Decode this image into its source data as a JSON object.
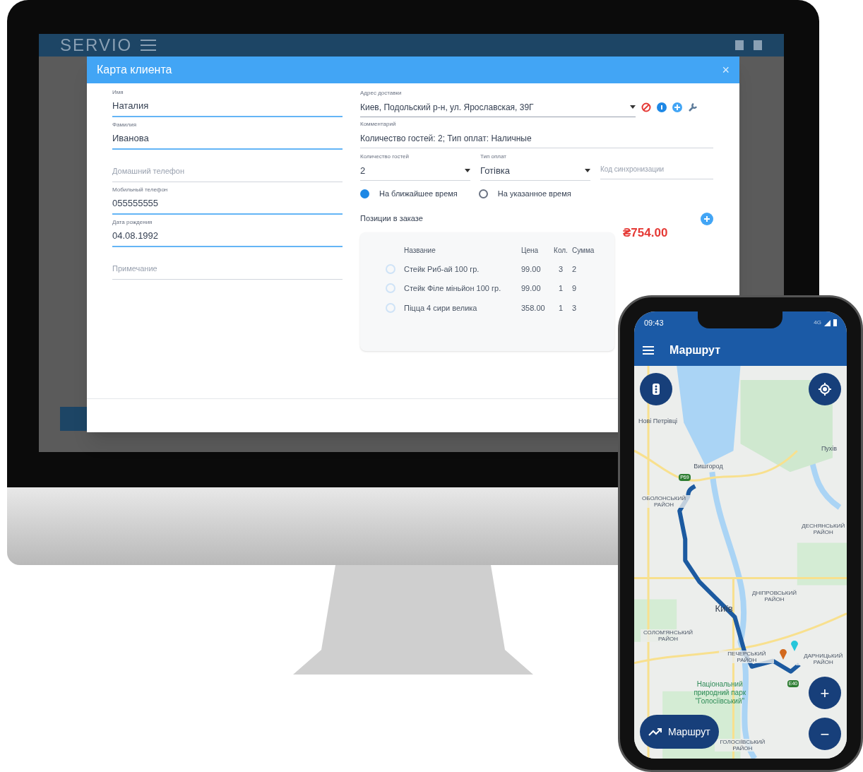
{
  "desktop": {
    "app_header": {
      "logo": "SERVIO"
    },
    "dialog": {
      "title": "Карта клиента",
      "close": "×",
      "left_fields": [
        {
          "label": "Имя",
          "value": "Наталия",
          "focused": true
        },
        {
          "label": "Фамилия",
          "value": "Иванова",
          "focused": true
        },
        {
          "placeholder": "Домашний телефон",
          "focused": false
        },
        {
          "label": "Мобильный телефон",
          "value": "055555555",
          "focused": true
        },
        {
          "label": "Дата рождения",
          "value": "04.08.1992",
          "focused": true
        },
        {
          "placeholder": "Примечание",
          "focused": false
        }
      ],
      "address": {
        "label": "Адрес доставки",
        "value": "Киев, Подольский р-н, ул. Ярославская, 39Г"
      },
      "comment": {
        "label": "Комментарий",
        "value": "Количество гостей: 2; Тип оплат: Наличные"
      },
      "guests": {
        "label": "Количество гостей",
        "value": "2"
      },
      "payment": {
        "label": "Тип оплат",
        "value": "Готівка"
      },
      "sync_code": {
        "placeholder": "Код синхронизации"
      },
      "time_options": [
        {
          "label": "На ближайшее время",
          "selected": true
        },
        {
          "label": "На указанное время",
          "selected": false
        }
      ],
      "positions_title": "Позиции в заказе",
      "total": "₴754.00",
      "table": {
        "columns": [
          "Название",
          "Цена",
          "Кол.",
          "Сумма"
        ],
        "rows": [
          {
            "name": "Стейк Риб-ай 100 гр.",
            "price": "99.00",
            "qty": "3",
            "sum": "2",
            "checked": false
          },
          {
            "name": "Стейк Філе міньйон 100 гр.",
            "price": "99.00",
            "qty": "1",
            "sum": "9",
            "checked": false
          },
          {
            "name": "Піцца 4 сири велика",
            "price": "358.00",
            "qty": "1",
            "sum": "3",
            "checked": false
          }
        ]
      }
    }
  },
  "phone": {
    "time": "09:43",
    "network": "4G",
    "title": "Маршрут",
    "map_labels": [
      {
        "text": "Нові Петрівці",
        "kind": "town"
      },
      {
        "text": "Пухів",
        "kind": "town"
      },
      {
        "text": "Вишгород",
        "kind": "town"
      },
      {
        "text": "Р69",
        "kind": "road"
      },
      {
        "text": "ОБОЛОНСЬКИЙ РАЙОН",
        "kind": "district"
      },
      {
        "text": "ДЕСНЯНСЬКИЙ РАЙОН",
        "kind": "district"
      },
      {
        "text": "ДНІПРОВСЬКИЙ РАЙОН",
        "kind": "district"
      },
      {
        "text": "Київ",
        "kind": "city"
      },
      {
        "text": "СОЛОМ'ЯНСЬКИЙ РАЙОН",
        "kind": "district"
      },
      {
        "text": "ПЕЧЕРСЬКИЙ РАЙОН",
        "kind": "district"
      },
      {
        "text": "ДАРНИЦЬКИЙ РАЙОН",
        "kind": "district"
      },
      {
        "text": "E40",
        "kind": "road"
      },
      {
        "text": "Національний природний парк \"Голосіївський\"",
        "kind": "park"
      },
      {
        "text": "ГОЛОСІЇВСЬКИЙ РАЙОН",
        "kind": "district"
      }
    ],
    "route_button": "Маршрут",
    "zoom_in": "+",
    "zoom_out": "−"
  }
}
